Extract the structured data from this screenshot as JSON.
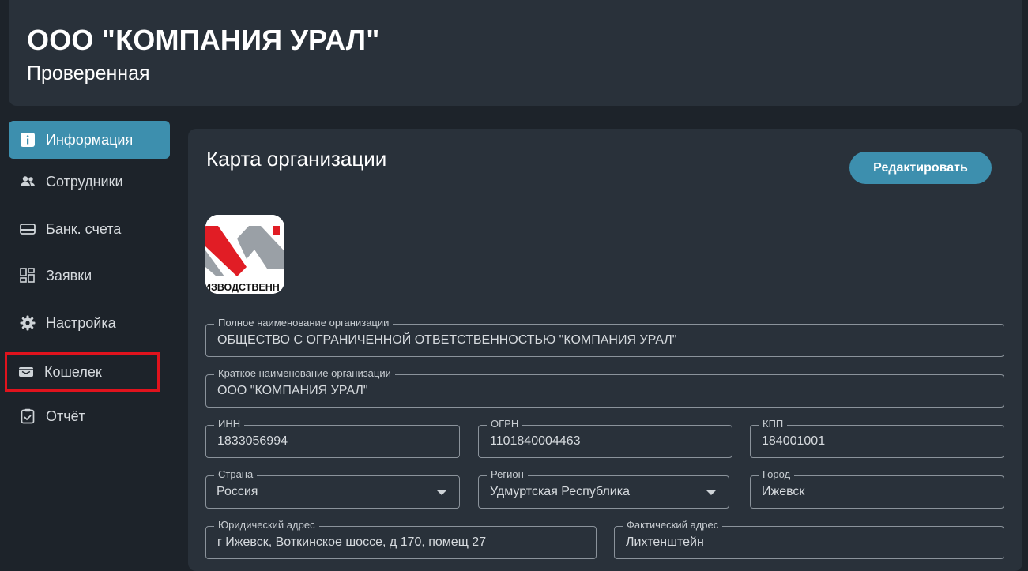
{
  "header": {
    "title": "ООО \"КОМПАНИЯ УРАЛ\"",
    "subtitle": "Проверенная"
  },
  "sidebar": {
    "items": [
      {
        "label": "Информация",
        "icon": "info-icon",
        "active": true
      },
      {
        "label": "Сотрудники",
        "icon": "people-icon",
        "active": false
      },
      {
        "label": "Банк. счета",
        "icon": "card-icon",
        "active": false
      },
      {
        "label": "Заявки",
        "icon": "grid-icon",
        "active": false
      },
      {
        "label": "Настройка",
        "icon": "gear-icon",
        "active": false
      },
      {
        "label": "Кошелек",
        "icon": "wallet-icon",
        "active": false
      },
      {
        "label": "Отчёт",
        "icon": "clipboard-icon",
        "active": false
      }
    ]
  },
  "panel": {
    "title": "Карта организации",
    "edit_label": "Редактировать",
    "logo_text": "ИЗВОДСТВЕНН"
  },
  "form": {
    "full_name": {
      "label": "Полное наименование организации",
      "value": "ОБЩЕСТВО С ОГРАНИЧЕННОЙ ОТВЕТСТВЕННОСТЬЮ \"КОМПАНИЯ УРАЛ\""
    },
    "short_name": {
      "label": "Краткое наименование организации",
      "value": "ООО \"КОМПАНИЯ УРАЛ\""
    },
    "inn": {
      "label": "ИНН",
      "value": "1833056994"
    },
    "ogrn": {
      "label": "ОГРН",
      "value": "1101840004463"
    },
    "kpp": {
      "label": "КПП",
      "value": "184001001"
    },
    "country": {
      "label": "Страна",
      "value": "Россия"
    },
    "region": {
      "label": "Регион",
      "value": "Удмуртская Республика"
    },
    "city": {
      "label": "Город",
      "value": "Ижевск"
    },
    "legal_address": {
      "label": "Юридический адрес",
      "value": "г Ижевск, Воткинское шоссе, д 170, помещ 27"
    },
    "actual_address": {
      "label": "Фактический адрес",
      "value": "Лихтенштейн"
    }
  },
  "colors": {
    "accent": "#3d8fae",
    "background": "#1d232a",
    "surface": "#29313a",
    "highlight": "#e0131d"
  }
}
